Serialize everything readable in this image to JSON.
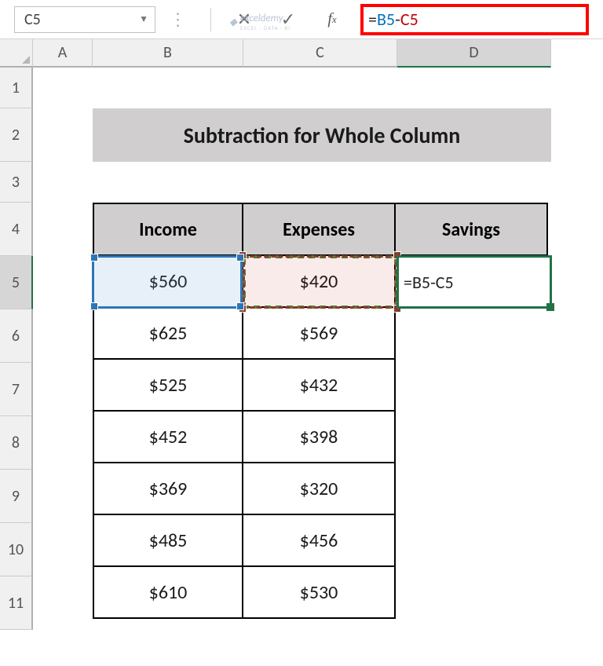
{
  "name_box": "C5",
  "formula": {
    "eq": "=",
    "ref1": "B5",
    "op": "-",
    "ref2": "C5"
  },
  "columns": [
    "A",
    "B",
    "C",
    "D"
  ],
  "rows": [
    "1",
    "2",
    "3",
    "4",
    "5",
    "6",
    "7",
    "8",
    "9",
    "10",
    "11"
  ],
  "title": "Subtraction for Whole Column",
  "headers": {
    "b": "Income",
    "c": "Expenses",
    "d": "Savings"
  },
  "data": [
    {
      "income": "$560",
      "expenses": "$420"
    },
    {
      "income": "$625",
      "expenses": "$569"
    },
    {
      "income": "$525",
      "expenses": "$432"
    },
    {
      "income": "$452",
      "expenses": "$398"
    },
    {
      "income": "$369",
      "expenses": "$320"
    },
    {
      "income": "$485",
      "expenses": "$456"
    },
    {
      "income": "$610",
      "expenses": "$530"
    }
  ],
  "editing_cell_display": "=B5-C5",
  "watermark": {
    "name": "exceldemy",
    "sub": "EXCEL · DATA · BI"
  }
}
